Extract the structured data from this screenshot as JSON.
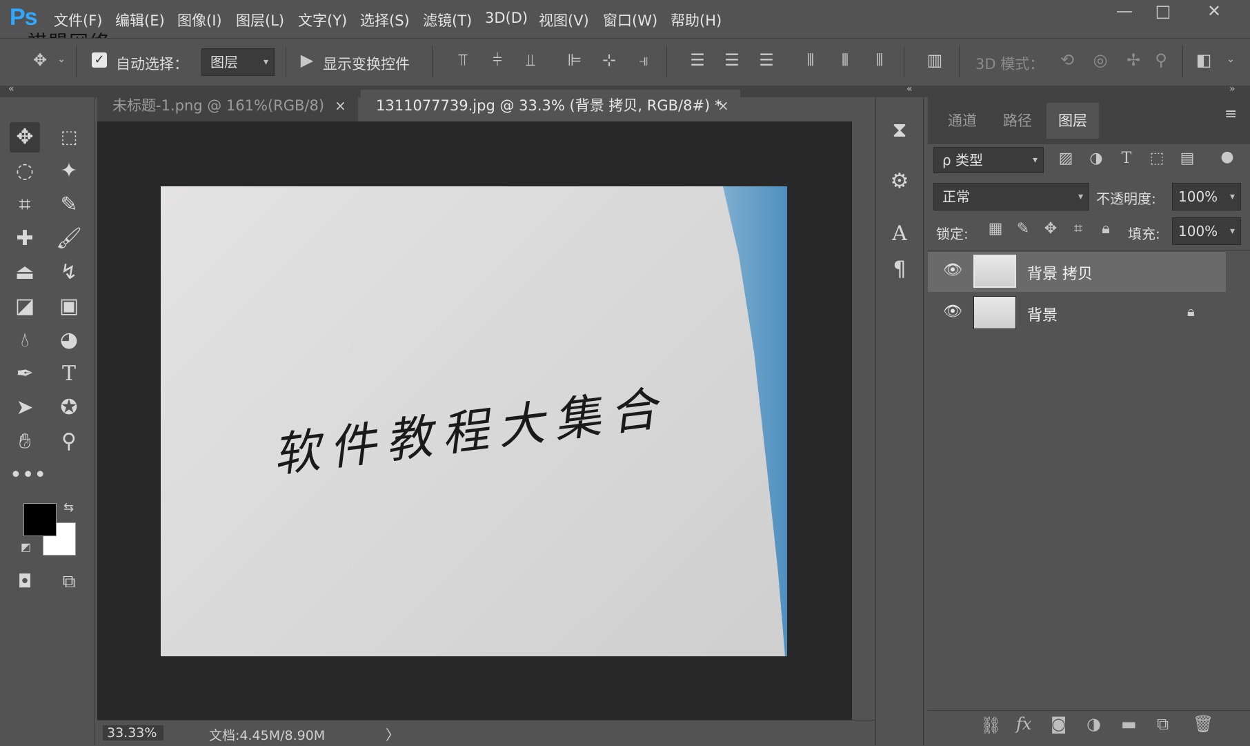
{
  "app": {
    "logo": "Ps",
    "watermark": "祺盟网络"
  },
  "menu": [
    "文件(F)",
    "编辑(E)",
    "图像(I)",
    "图层(L)",
    "文字(Y)",
    "选择(S)",
    "滤镜(T)",
    "3D(D)",
    "视图(V)",
    "窗口(W)",
    "帮助(H)"
  ],
  "window_controls": {
    "minimize": "—",
    "maximize": "□",
    "close": "✕"
  },
  "options": {
    "auto_select_label": "自动选择：",
    "auto_select_checked": true,
    "auto_select_value": "图层",
    "show_transform_label": "显示变换控件",
    "mode3d_label": "3D 模式："
  },
  "tabs": [
    {
      "title": "未标题-1.png @ 161%(RGB/8)",
      "close": "×",
      "active": false
    },
    {
      "title": "1311077739.jpg @ 33.3% (背景 拷贝, RGB/8#) *",
      "close": "×",
      "active": true
    }
  ],
  "canvas": {
    "handwriting": "软件教程大集合",
    "zoom": "33.33%",
    "doc_info": "文档:4.45M/8.90M",
    "status_arrow": "〉"
  },
  "panel": {
    "tabs": [
      "通道",
      "路径",
      "图层"
    ],
    "active_tab": "图层",
    "filter_label": "ρ 类型",
    "blend_mode": "正常",
    "opacity_label": "不透明度:",
    "opacity_value": "100%",
    "lock_label": "锁定:",
    "fill_label": "填充:",
    "fill_value": "100%",
    "layers": [
      {
        "name": "背景 拷贝",
        "visible": true,
        "selected": true,
        "locked": false
      },
      {
        "name": "背景",
        "visible": true,
        "selected": false,
        "locked": true
      }
    ]
  },
  "colors": {
    "foreground": "#000000",
    "background": "#ffffff",
    "accent": "#31a8ff"
  }
}
